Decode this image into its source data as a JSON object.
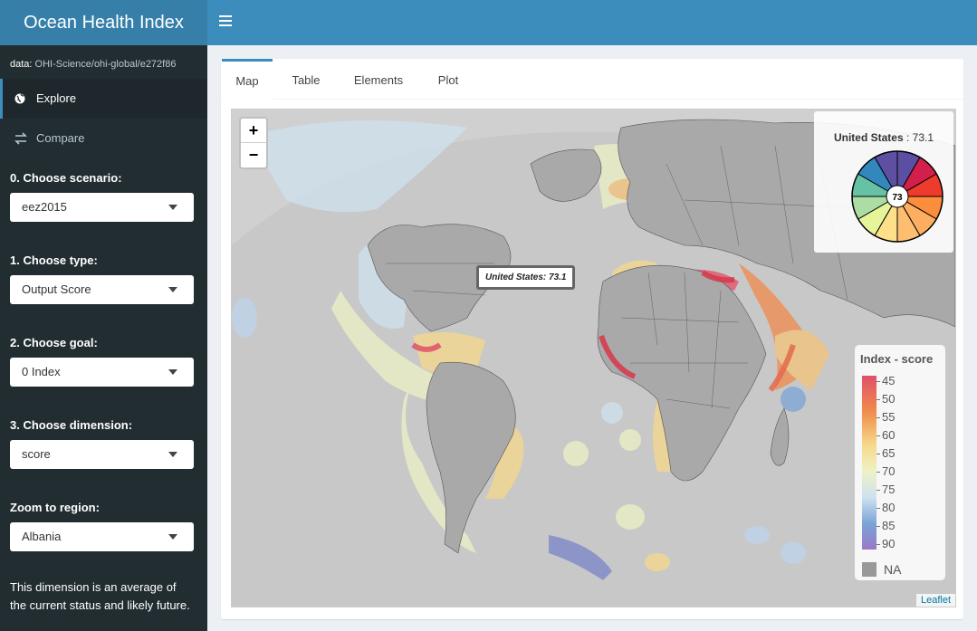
{
  "app": {
    "title": "Ocean Health Index"
  },
  "sidebar": {
    "data_prefix": "data:",
    "data_link": "OHI-Science/ohi-global/e272f86",
    "menu": [
      {
        "label": "Explore",
        "icon": "globe-icon",
        "active": true
      },
      {
        "label": "Compare",
        "icon": "exchange-icon",
        "active": false
      }
    ],
    "controls": [
      {
        "label": "0. Choose scenario:",
        "value": "eez2015"
      },
      {
        "label": "1. Choose type:",
        "value": "Output Score"
      },
      {
        "label": "2. Choose goal:",
        "value": "0 Index"
      },
      {
        "label": "3. Choose dimension:",
        "value": "score"
      },
      {
        "label": "Zoom to region:",
        "value": "Albania"
      }
    ],
    "description": "This dimension is an average of the current status and likely future."
  },
  "tabs": [
    "Map",
    "Table",
    "Elements",
    "Plot"
  ],
  "active_tab": "Map",
  "map": {
    "zoom_in": "+",
    "zoom_out": "−",
    "tooltip": "United States: 73.1",
    "info": {
      "region": "United States",
      "separator": " : ",
      "score": "73.1",
      "flower_center": "73"
    },
    "legend": {
      "title": "Index - score",
      "ticks": [
        "45",
        "50",
        "55",
        "60",
        "65",
        "70",
        "75",
        "80",
        "85",
        "90"
      ],
      "na_label": "NA"
    },
    "attribution": "Leaflet",
    "colors": {
      "low": "#e0506a",
      "mid": "#f6d98a",
      "high": "#9a78c9",
      "land": "#a9a9a9",
      "ocean": "#d0d0d0"
    }
  }
}
